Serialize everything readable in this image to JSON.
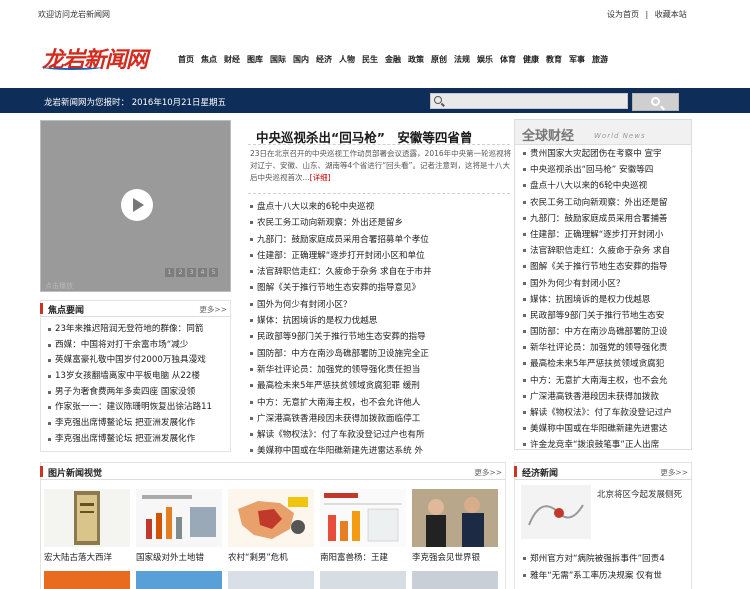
{
  "topbar": {
    "welcome": "欢迎访问龙岩新闻网",
    "set_home": "设为首页",
    "sep": "|",
    "bookmark": "收藏本站"
  },
  "logo": {
    "text": "龙岩新闻网"
  },
  "nav": [
    "首页",
    "焦点",
    "财经",
    "图库",
    "国际",
    "国内",
    "经济",
    "人物",
    "民生",
    "金融",
    "政策",
    "原创",
    "法规",
    "娱乐",
    "体育",
    "健康",
    "教育",
    "军事",
    "旅游"
  ],
  "datebar": {
    "text": "龙岩新闻网为您报时： 2016年10月21日星期五"
  },
  "search": {
    "placeholder": ""
  },
  "video": {
    "controls": [
      "1",
      "2",
      "3",
      "4",
      "5"
    ],
    "caption": "点击播放"
  },
  "headline": {
    "title": "中央巡视杀出“回马枪”　安徽等四省曾",
    "summary": "23日在北京召开的中央巡视工作动员部署会议透露，2016年中央第一轮巡视将对辽宁、安徽、山东、湖南等4个省进行“回头看”。记者注意到，这将是十八大后中央巡视首次...",
    "more_label": "[详细]"
  },
  "center_news": [
    "盘点十八大以来的6轮中央巡视",
    "农民工务工动向新观察：外出还是留乡",
    "九部门：鼓励家庭成员采用合署招募单个孝位",
    "住建部：正确理解“逐步打开封闭小区和单位",
    "法官辞职信走红：久疲命于杂务 求自在于市井",
    "图解《关于推行节地生态安葬的指导意见》",
    "国外为何少有封闭小区？",
    "媒体：抗困境诉的是权力伐越思",
    "民政部等9部门关于推行节地生态安葬的指导",
    "国防部：中方在南沙岛礁部署防卫设施完全正",
    "新华社评论员：加强党的领导强化责任担当",
    "最高检未来5年严惩扶贫领域贪腐犯罪 缓刑",
    "中方：无意扩大南海主权，也不会允许他人",
    "广深港高铁香港段因未获得加拨款面临停工",
    "解读《物权法》：付了车款没登记过户也有所",
    "美媒称中国或在华阳礁新建先进雷达系统 外"
  ],
  "global_finance": {
    "title_cn": "全球财经",
    "title_en": "World News",
    "items": [
      "贵州国家大灾起团伤在考察中 宣宇",
      "中央巡视杀出“回马枪” 安徽等四",
      "盘点十八大以来的6轮中央巡视",
      "农民工务工动向新观察：外出还是留",
      "九部门：鼓励家庭成员采用合署捕善",
      "住建部：正确理解“逐步打开封闭小",
      "法官辞职信走红：久疲命于杂务 求自",
      "图解《关于推行节地生态安葬的指导",
      "国外为何少有封闭小区？",
      "媒体：抗困境诉的是权力伐越恩",
      "民政部等9部门关于推行节地生态安",
      "国防部：中方在南沙岛礁部署防卫设",
      "新华社评论员：加强党的领导强化责",
      "最高检未来5年严惩扶贫领域贪腐犯",
      "中方：无意扩大南海主权，也不会允",
      "广深港高铁香港段因未获得加拨款",
      "解读《物权法》：付了车款没登记过户",
      "美媒称中国或在华阳礁新建先进雷达",
      "许金龙竞幸“拨浪鼓笔事”正人出席"
    ]
  },
  "focus": {
    "title": "焦点要闻",
    "more": "更多>>",
    "items": [
      "23年来推迟陪润无登符地的群像：同箭",
      "西媒：中国将对打干余富市场“减少",
      "英媒富豪礼敬中国岁付2000万独具漫戏",
      "13岁女孩翻墙离家中平板电脑 从22楼",
      "男子为奢食费两年多卖四座 国家没领",
      "作家张一一：建议陈珊明恢复出徐沾路11",
      "李克强出席博鳌论坛 把亚洲发展化作",
      "李克强出席博鳌论坛 把亚洲发展化作"
    ]
  },
  "photo_news": {
    "title": "图片新闻视觉",
    "more": "更多>>",
    "captions": [
      "宏大陆古落大西洋",
      "国家级对外土地错",
      "农村“剩男”危机",
      "南阳富兽杨：王建",
      "李克强会见世界银"
    ]
  },
  "economy": {
    "title": "经济新闻",
    "more": "更多>>",
    "feature": "北京将区今起发展侧死",
    "items": [
      "郑州官方对“病院被强拆事件”回责4",
      "雅年“无需”系工率历决规案 仅有世"
    ]
  }
}
